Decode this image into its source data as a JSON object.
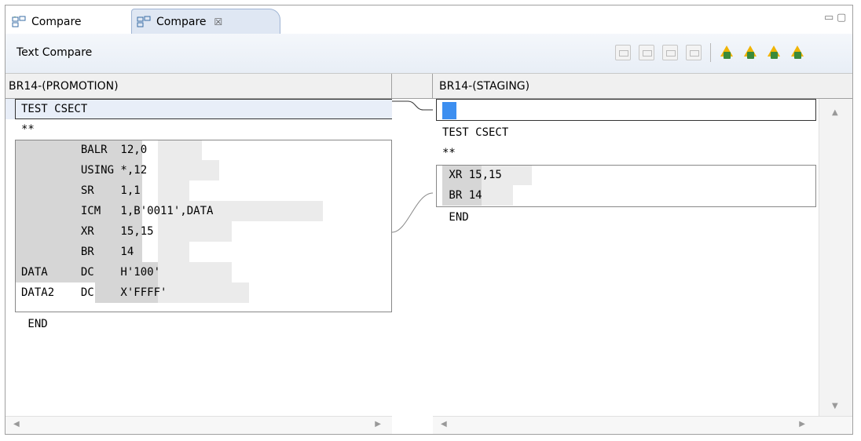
{
  "tabs": [
    {
      "label": "Compare",
      "active": false
    },
    {
      "label": "Compare",
      "active": true,
      "close": "☒"
    }
  ],
  "window_controls": {
    "minimize": "▭",
    "maximize": "▢"
  },
  "toolbar": {
    "title": "Text Compare"
  },
  "left": {
    "header": "BR14-(PROMOTION)",
    "lines": [
      "TEST CSECT",
      "**",
      "         BALR  12,0",
      "         USING *,12",
      "         SR    1,1",
      "         ICM   1,B'0011',DATA",
      "         XR    15,15",
      "         BR    14",
      "DATA     DC    H'100'",
      "DATA2    DC    X'FFFF'",
      " END"
    ]
  },
  "right": {
    "header": "BR14-(STAGING)",
    "lines": [
      "",
      "TEST CSECT",
      "**",
      " XR 15,15",
      " BR 14",
      " END"
    ]
  },
  "scroll": {
    "left_arrow": "◀",
    "right_arrow": "▶",
    "up_arrow": "▲",
    "down_arrow": "▼"
  },
  "colors": {
    "accent": "#3d8ff0",
    "changed": "#d6d6d6",
    "current_line": "#e8eef8"
  }
}
